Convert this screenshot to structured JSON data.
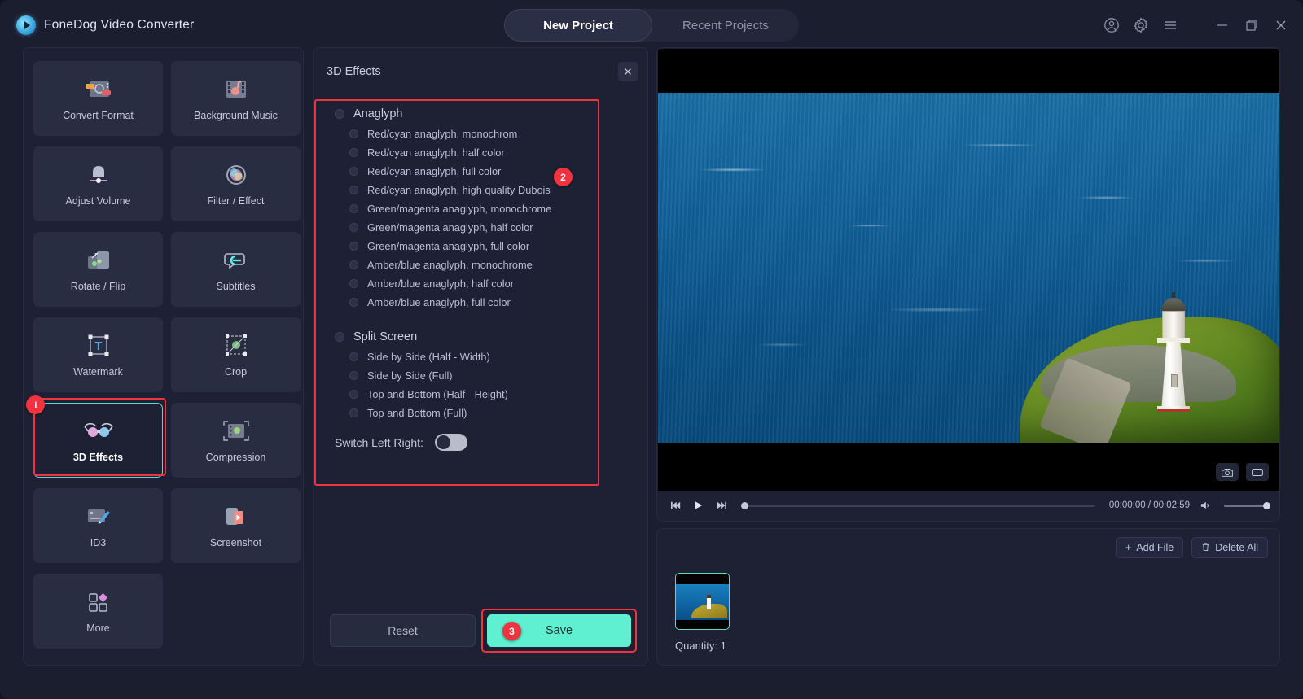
{
  "app": {
    "title": "FoneDog Video Converter",
    "logo_icon": "play-logo-icon"
  },
  "tabs": [
    {
      "label": "New Project",
      "active": true
    },
    {
      "label": "Recent Projects",
      "active": false
    }
  ],
  "window_controls": [
    {
      "name": "account-icon",
      "label": "Account"
    },
    {
      "name": "settings-gear-icon",
      "label": "Settings"
    },
    {
      "name": "menu-hamburger-icon",
      "label": "Menu"
    },
    {
      "name": "minimize-icon",
      "label": "Minimize"
    },
    {
      "name": "maximize-icon",
      "label": "Maximize"
    },
    {
      "name": "close-icon",
      "label": "Close"
    }
  ],
  "sidebar": {
    "tiles": [
      {
        "label": "Convert Format",
        "icon": "convert-format-icon",
        "selected": false
      },
      {
        "label": "Background Music",
        "icon": "background-music-icon",
        "selected": false
      },
      {
        "label": "Adjust Volume",
        "icon": "adjust-volume-icon",
        "selected": false
      },
      {
        "label": "Filter / Effect",
        "icon": "filter-effect-icon",
        "selected": false
      },
      {
        "label": "Rotate / Flip",
        "icon": "rotate-flip-icon",
        "selected": false
      },
      {
        "label": "Subtitles",
        "icon": "subtitles-icon",
        "selected": false
      },
      {
        "label": "Watermark",
        "icon": "watermark-icon",
        "selected": false
      },
      {
        "label": "Crop",
        "icon": "crop-icon",
        "selected": false
      },
      {
        "label": "3D Effects",
        "icon": "3d-glasses-icon",
        "selected": true
      },
      {
        "label": "Compression",
        "icon": "compression-icon",
        "selected": false
      },
      {
        "label": "ID3",
        "icon": "id3-tag-icon",
        "selected": false
      },
      {
        "label": "Screenshot",
        "icon": "screenshot-icon",
        "selected": false
      },
      {
        "label": "More",
        "icon": "more-grid-icon",
        "selected": false
      }
    ]
  },
  "panel": {
    "title": "3D Effects",
    "close_icon": "close-icon",
    "groups": [
      {
        "name": "Anaglyph",
        "options": [
          "Red/cyan anaglyph, monochrom",
          "Red/cyan anaglyph, half color",
          "Red/cyan anaglyph, full color",
          "Red/cyan anaglyph, high quality Dubois",
          "Green/magenta anaglyph, monochrome",
          "Green/magenta anaglyph, half color",
          "Green/magenta anaglyph, full color",
          "Amber/blue anaglyph, monochrome",
          "Amber/blue anaglyph, half color",
          "Amber/blue anaglyph, full color"
        ]
      },
      {
        "name": "Split Screen",
        "options": [
          "Side by Side (Half - Width)",
          "Side by Side (Full)",
          "Top and Bottom (Half - Height)",
          "Top and Bottom (Full)"
        ]
      }
    ],
    "switch": {
      "label": "Switch Left Right:",
      "on": false
    },
    "reset_label": "Reset",
    "save_label": "Save"
  },
  "annotations": [
    {
      "number": "1",
      "target": "3d-effects-tile"
    },
    {
      "number": "2",
      "target": "anaglyph-options-panel"
    },
    {
      "number": "3",
      "target": "save-button"
    }
  ],
  "player": {
    "prev_icon": "skip-previous-icon",
    "play_icon": "play-icon",
    "next_icon": "skip-next-icon",
    "time": "00:00:00 / 00:02:59",
    "volume_icon": "volume-icon",
    "snapshot_icon": "camera-icon",
    "gif_icon": "gif-capture-icon"
  },
  "filelist": {
    "add_file_label": "Add File",
    "add_file_icon": "plus-icon",
    "delete_all_label": "Delete All",
    "delete_all_icon": "trash-icon",
    "quantity": "Quantity: 1",
    "thumbnail_name": "video-thumbnail"
  },
  "colors": {
    "accent_teal": "#5ff0d2",
    "highlight_red": "#f0333f",
    "panel_bg": "#1d2133",
    "app_bg": "#1b1e2e",
    "tile_bg": "#282d41"
  }
}
